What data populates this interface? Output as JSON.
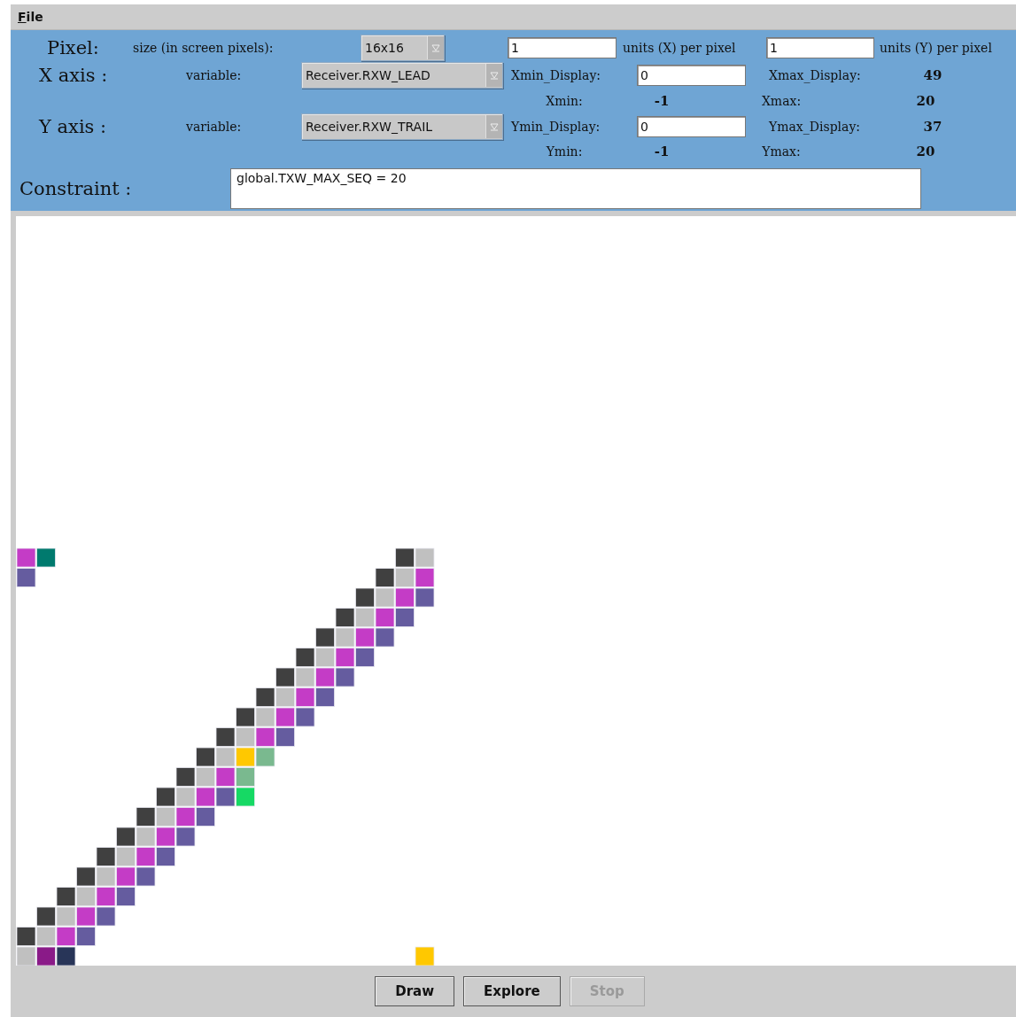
{
  "menu": [
    {
      "label": "File"
    }
  ],
  "pixel": {
    "label": "Pixel:",
    "size_label": "size (in screen pixels):",
    "size": "16x16",
    "x_units": "1",
    "x_units_label": "units (X) per pixel",
    "y_units": "1",
    "y_units_label": "units (Y) per pixel"
  },
  "axes": [
    {
      "label": "X axis :",
      "variable_label": "variable:",
      "variable": "Receiver.RXW_LEAD",
      "min_display_label": "Xmin_Display:",
      "min_display": "0",
      "max_display_label": "Xmax_Display:",
      "max_display": "49",
      "min_label": "Xmin:",
      "min": "-1",
      "max_label": "Xmax:",
      "max": "20"
    },
    {
      "label": "Y axis :",
      "variable_label": "variable:",
      "variable": "Receiver.RXW_TRAIL",
      "min_display_label": "Ymin_Display:",
      "min_display": "0",
      "max_display_label": "Ymax_Display:",
      "max_display": "37",
      "min_label": "Ymin:",
      "min": "-1",
      "max_label": "Ymax:",
      "max": "20"
    }
  ],
  "constraint": {
    "label": "Constraint :",
    "value": "global.TXW_MAX_SEQ = 20"
  },
  "buttons": [
    {
      "label": "Draw",
      "disabled": false
    },
    {
      "label": "Explore",
      "disabled": false
    },
    {
      "label": "Stop",
      "disabled": true
    }
  ]
}
